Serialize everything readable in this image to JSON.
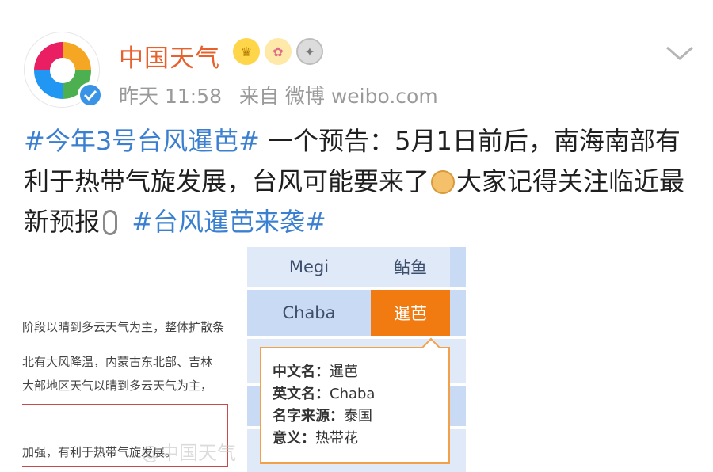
{
  "account": {
    "name": "中国天气",
    "time": "昨天 11:58",
    "source": "来自 微博 weibo.com"
  },
  "post": {
    "hashtag1": "#今年3号台风暹芭#",
    "text1": " 一个预告：5月1日前后，南海南部有利于热带气旋发展，台风可能要来了",
    "text2": "大家记得关注临近最新预报",
    "hashtag2": " #台风暹芭来袭#"
  },
  "embed": {
    "doc_lines": [
      "阶段以晴到多云天气为主，整体扩散条",
      "北有大风降温，内蒙古东北部、吉林",
      "大部地区天气以晴到多云天气为主，",
      "加强，有利于热带气旋发展。"
    ],
    "table": {
      "megi_en": "Megi",
      "megi_cn": "鲇鱼",
      "chaba_en": "Chaba",
      "chaba_cn": "暹芭"
    },
    "tooltip": {
      "cn_key": "中文名：",
      "cn_val": "暹芭",
      "en_key": "英文名：",
      "en_val": "Chaba",
      "origin_key": "名字来源：",
      "origin_val": "泰国",
      "meaning_key": "意义：",
      "meaning_val": "热带花"
    },
    "watermark": "@中国天气"
  },
  "colors": {
    "username": "#e8602c",
    "hashtag": "#3b7fd0",
    "meta": "#9a9a9a",
    "highlight": "#f17b11"
  },
  "icons": [
    "avatar-logo",
    "verified-icon",
    "crown-badge-icon",
    "emoji-badge-icon",
    "medal-badge-icon",
    "chevron-down-icon",
    "dog-emoji-icon",
    "microphone-icon"
  ]
}
